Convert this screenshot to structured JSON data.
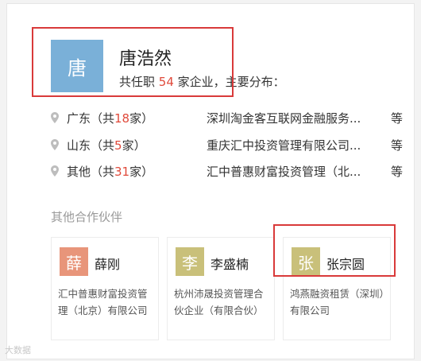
{
  "person": {
    "avatar_char": "唐",
    "avatar_color": "#7ab0d8",
    "name": "唐浩然",
    "summary_prefix": "共任职",
    "company_count": "54",
    "summary_suffix": "家企业，主要分布："
  },
  "regions": [
    {
      "label_prefix": "广东（共",
      "count": "18",
      "label_suffix": "家）",
      "company": "深圳淘金客互联网金融服务...",
      "more": "等"
    },
    {
      "label_prefix": "山东（共",
      "count": "5",
      "label_suffix": "家）",
      "company": "重庆汇中投资管理有限公司...",
      "more": "等"
    },
    {
      "label_prefix": "其他（共",
      "count": "31",
      "label_suffix": "家）",
      "company": "汇中普惠财富投资管理（北...",
      "more": "等"
    }
  ],
  "partners_title": "其他合作伙伴",
  "partners": [
    {
      "avatar_char": "薛",
      "avatar_color": "#e8957a",
      "name": "薛刚",
      "company": "汇中普惠财富投资管理（北京）有限公司"
    },
    {
      "avatar_char": "李",
      "avatar_color": "#c9c07a",
      "name": "李盛楠",
      "company": "杭州沛晟投资管理合伙企业（有限合伙）"
    },
    {
      "avatar_char": "张",
      "avatar_color": "#c9c07a",
      "name": "张宗圆",
      "company": "鸿燕融资租赁（深圳）有限公司"
    }
  ],
  "watermark": "大数据"
}
